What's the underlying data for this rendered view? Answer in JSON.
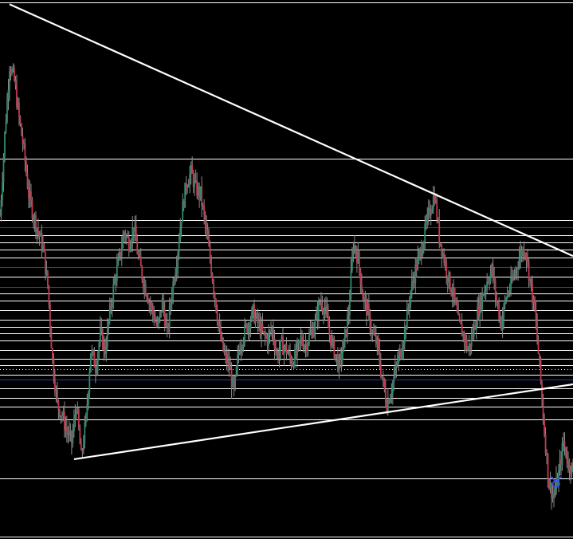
{
  "chart_data": {
    "type": "candlestick",
    "title": "",
    "xlabel": "",
    "ylabel": "",
    "grid": false,
    "x_range": [
      0,
      240
    ],
    "ylim": [
      0,
      100
    ],
    "colors": {
      "background": "#000000",
      "up": "#2e8b70",
      "down": "#c23a4f",
      "wick": "#8a8a8a",
      "level_white": "#ffffff",
      "level_blue": "#2b3aa8",
      "trendline": "#ffffff",
      "marker": "#3355ff"
    },
    "horizontal_levels": [
      {
        "y": 99.6,
        "color": "white"
      },
      {
        "y": 70.5,
        "color": "white"
      },
      {
        "y": 59.2,
        "color": "white"
      },
      {
        "y": 57.8,
        "color": "blue"
      },
      {
        "y": 56.4,
        "color": "white"
      },
      {
        "y": 55.1,
        "color": "white"
      },
      {
        "y": 53.7,
        "color": "white"
      },
      {
        "y": 52.2,
        "color": "white"
      },
      {
        "y": 50.5,
        "color": "blue"
      },
      {
        "y": 48.7,
        "color": "white"
      },
      {
        "y": 46.8,
        "color": "blue"
      },
      {
        "y": 45.6,
        "color": "white"
      },
      {
        "y": 44.3,
        "color": "white"
      },
      {
        "y": 42.5,
        "color": "white"
      },
      {
        "y": 40.7,
        "color": "white"
      },
      {
        "y": 39.4,
        "color": "white"
      },
      {
        "y": 38.1,
        "color": "white"
      },
      {
        "y": 36.8,
        "color": "white"
      },
      {
        "y": 35.1,
        "color": "white"
      },
      {
        "y": 33.5,
        "color": "white"
      },
      {
        "y": 32.3,
        "color": "white"
      },
      {
        "y": 31.5,
        "color": "white",
        "dotted": true
      },
      {
        "y": 30.5,
        "color": "white"
      },
      {
        "y": 29.6,
        "color": "blue"
      },
      {
        "y": 28.0,
        "color": "white"
      },
      {
        "y": 26.2,
        "color": "white"
      },
      {
        "y": 24.5,
        "color": "white"
      },
      {
        "y": 22.2,
        "color": "white"
      },
      {
        "y": 11.2,
        "color": "white"
      },
      {
        "y": 0.5,
        "color": "white"
      }
    ],
    "trendlines": [
      {
        "x1": 4,
        "y1": 99.2,
        "x2": 240,
        "y2": 52.5
      },
      {
        "x1": 31,
        "y1": 14.8,
        "x2": 240,
        "y2": 28.7
      }
    ],
    "marker": {
      "x": 233,
      "y": 10.3,
      "symbol": "♉"
    },
    "price_path": [
      [
        0,
        60
      ],
      [
        2,
        75
      ],
      [
        4,
        88
      ],
      [
        6,
        85
      ],
      [
        8,
        78
      ],
      [
        10,
        72
      ],
      [
        12,
        64
      ],
      [
        14,
        60
      ],
      [
        16,
        57
      ],
      [
        18,
        54
      ],
      [
        20,
        47
      ],
      [
        22,
        33
      ],
      [
        24,
        25
      ],
      [
        26,
        23
      ],
      [
        28,
        20
      ],
      [
        30,
        18
      ],
      [
        32,
        25
      ],
      [
        34,
        15
      ],
      [
        36,
        22
      ],
      [
        38,
        35
      ],
      [
        40,
        32
      ],
      [
        42,
        38
      ],
      [
        44,
        35
      ],
      [
        46,
        42
      ],
      [
        48,
        48
      ],
      [
        50,
        52
      ],
      [
        52,
        57
      ],
      [
        54,
        55
      ],
      [
        56,
        58
      ],
      [
        58,
        52
      ],
      [
        60,
        48
      ],
      [
        62,
        45
      ],
      [
        64,
        42
      ],
      [
        66,
        39
      ],
      [
        68,
        44
      ],
      [
        70,
        38
      ],
      [
        72,
        46
      ],
      [
        74,
        52
      ],
      [
        76,
        60
      ],
      [
        78,
        66
      ],
      [
        80,
        68
      ],
      [
        82,
        65
      ],
      [
        84,
        64
      ],
      [
        86,
        58
      ],
      [
        88,
        52
      ],
      [
        90,
        45
      ],
      [
        92,
        38
      ],
      [
        94,
        34
      ],
      [
        96,
        32
      ],
      [
        98,
        27
      ],
      [
        100,
        35
      ],
      [
        102,
        38
      ],
      [
        104,
        40
      ],
      [
        106,
        42
      ],
      [
        108,
        40
      ],
      [
        110,
        38
      ],
      [
        112,
        37
      ],
      [
        114,
        39
      ],
      [
        116,
        34
      ],
      [
        118,
        36
      ],
      [
        120,
        35
      ],
      [
        122,
        33
      ],
      [
        124,
        34
      ],
      [
        126,
        37
      ],
      [
        128,
        36
      ],
      [
        130,
        38
      ],
      [
        132,
        40
      ],
      [
        134,
        44
      ],
      [
        136,
        43
      ],
      [
        138,
        38
      ],
      [
        140,
        35
      ],
      [
        142,
        32
      ],
      [
        144,
        36
      ],
      [
        146,
        42
      ],
      [
        148,
        55
      ],
      [
        150,
        52
      ],
      [
        152,
        45
      ],
      [
        154,
        42
      ],
      [
        156,
        38
      ],
      [
        158,
        36
      ],
      [
        160,
        30
      ],
      [
        162,
        25
      ],
      [
        164,
        28
      ],
      [
        166,
        32
      ],
      [
        168,
        35
      ],
      [
        170,
        40
      ],
      [
        172,
        46
      ],
      [
        174,
        50
      ],
      [
        176,
        53
      ],
      [
        178,
        57
      ],
      [
        180,
        61
      ],
      [
        182,
        64
      ],
      [
        184,
        56
      ],
      [
        186,
        52
      ],
      [
        188,
        48
      ],
      [
        190,
        45
      ],
      [
        192,
        40
      ],
      [
        194,
        38
      ],
      [
        196,
        35
      ],
      [
        198,
        38
      ],
      [
        200,
        42
      ],
      [
        202,
        45
      ],
      [
        204,
        48
      ],
      [
        206,
        50
      ],
      [
        208,
        44
      ],
      [
        210,
        40
      ],
      [
        212,
        45
      ],
      [
        214,
        47
      ],
      [
        216,
        50
      ],
      [
        218,
        53
      ],
      [
        220,
        54
      ],
      [
        222,
        48
      ],
      [
        224,
        42
      ],
      [
        226,
        32
      ],
      [
        228,
        20
      ],
      [
        230,
        10
      ],
      [
        232,
        8
      ],
      [
        234,
        12
      ],
      [
        236,
        18
      ],
      [
        238,
        14
      ],
      [
        240,
        13
      ]
    ]
  }
}
